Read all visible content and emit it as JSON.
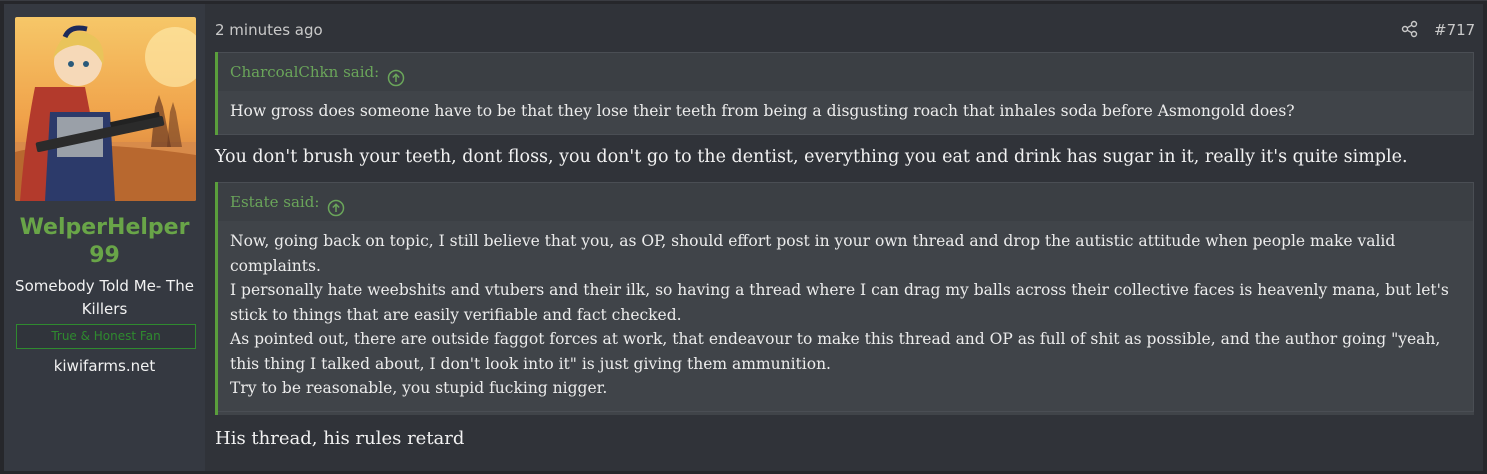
{
  "user": {
    "name": "WelperHelper99",
    "title": "Somebody Told Me- The Killers",
    "banner": "True & Honest Fan",
    "site": "kiwifarms.net",
    "avatar_icon": "avatar-image"
  },
  "post": {
    "timestamp": "2 minutes ago",
    "number": "#717",
    "share_icon": "share-icon"
  },
  "quotes": [
    {
      "author": "CharcoalChkn said:",
      "lines": [
        "How gross does someone have to be that they lose their teeth from being a disgusting roach that inhales soda before Asmongold does?"
      ]
    },
    {
      "author": "Estate said:",
      "lines": [
        "Now, going back on topic, I still believe that you, as OP, should effort post in your own thread and drop the autistic attitude when people make valid",
        "complaints.",
        "I personally hate weebshits and vtubers and their ilk, so having a thread where I can drag my balls across their collective faces is heavenly mana, but let's",
        "stick to things that are easily verifiable and fact checked.",
        "As pointed out, there are outside faggot forces at work, that endeavour to make this thread and OP as full of shit as possible, and the author going \"yeah,",
        "this thing I talked about, I don't look into it\" is just giving them ammunition.",
        "Try to be reasonable, you stupid fucking nigger."
      ]
    }
  ],
  "replies": [
    "You don't brush your teeth, dont floss, you don't go to the dentist, everything you eat and drink has sugar in it, really it's quite simple.",
    "His thread, his rules retard"
  ],
  "colors": {
    "accent_green": "#69a548",
    "quote_border": "#5a9e3c",
    "banner_green": "#2f8a2f"
  }
}
